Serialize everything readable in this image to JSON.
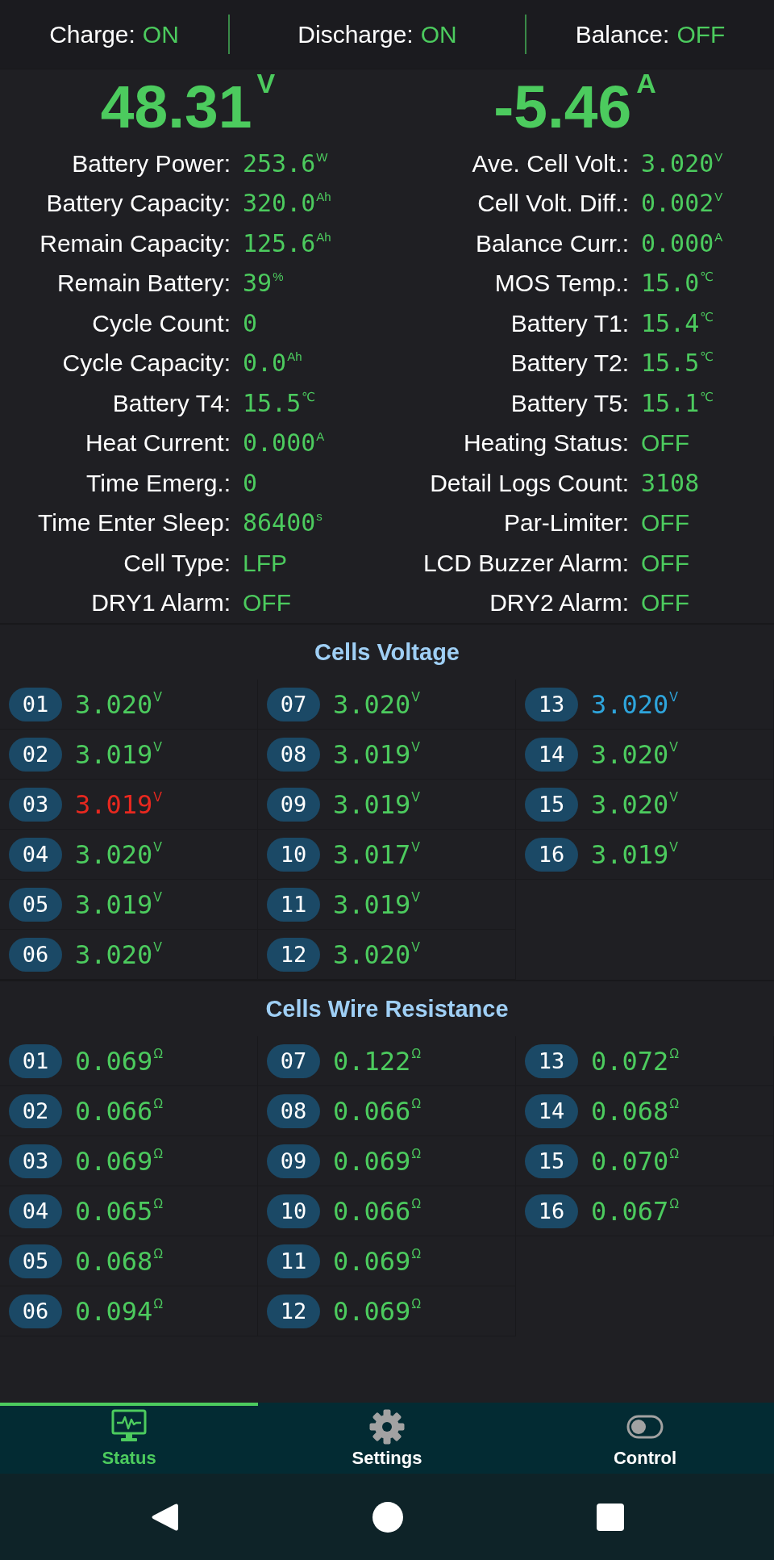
{
  "status_bar": [
    {
      "label": "Charge:",
      "value": "ON"
    },
    {
      "label": "Discharge:",
      "value": "ON"
    },
    {
      "label": "Balance:",
      "value": "OFF"
    }
  ],
  "columns": [
    {
      "reading": {
        "value": "48.31",
        "unit": "V"
      },
      "stats": [
        {
          "label": "Battery Power:",
          "value": "253.6",
          "unit": "W",
          "kind": "number"
        },
        {
          "label": "Battery Capacity:",
          "value": "320.0",
          "unit": "Ah",
          "kind": "number"
        },
        {
          "label": "Remain Capacity:",
          "value": "125.6",
          "unit": "Ah",
          "kind": "number"
        },
        {
          "label": "Remain Battery:",
          "value": "39",
          "unit": "%",
          "kind": "number"
        },
        {
          "label": "Cycle Count:",
          "value": "0",
          "kind": "number"
        },
        {
          "label": "Cycle Capacity:",
          "value": "0.0",
          "unit": "Ah",
          "kind": "number"
        },
        {
          "label": "Battery T4:",
          "value": "15.5",
          "unit": "℃",
          "kind": "number"
        },
        {
          "label": "Heat Current:",
          "value": "0.000",
          "unit": "A",
          "kind": "number"
        },
        {
          "label": "Time Emerg.:",
          "value": "0",
          "kind": "number"
        },
        {
          "label": "Time Enter Sleep:",
          "value": "86400",
          "unit": "s",
          "kind": "number"
        },
        {
          "label": "Cell Type:",
          "value": "LFP",
          "kind": "text"
        },
        {
          "label": "DRY1 Alarm:",
          "value": "OFF",
          "kind": "text"
        }
      ]
    },
    {
      "reading": {
        "value": "-5.46",
        "unit": "A"
      },
      "stats": [
        {
          "label": "Ave. Cell Volt.:",
          "value": "3.020",
          "unit": "V",
          "kind": "number"
        },
        {
          "label": "Cell Volt. Diff.:",
          "value": "0.002",
          "unit": "V",
          "kind": "number"
        },
        {
          "label": "Balance Curr.:",
          "value": "0.000",
          "unit": "A",
          "kind": "number"
        },
        {
          "label": "MOS Temp.:",
          "value": "15.0",
          "unit": "℃",
          "kind": "number"
        },
        {
          "label": "Battery T1:",
          "value": "15.4",
          "unit": "℃",
          "kind": "number"
        },
        {
          "label": "Battery T2:",
          "value": "15.5",
          "unit": "℃",
          "kind": "number"
        },
        {
          "label": "Battery T5:",
          "value": "15.1",
          "unit": "℃",
          "kind": "number"
        },
        {
          "label": "Heating Status:",
          "value": "OFF",
          "kind": "text"
        },
        {
          "label": "Detail Logs Count:",
          "value": "3108",
          "kind": "number"
        },
        {
          "label": "Par-Limiter:",
          "value": "OFF",
          "kind": "text"
        },
        {
          "label": "LCD Buzzer Alarm:",
          "value": "OFF",
          "kind": "text"
        },
        {
          "label": "DRY2 Alarm:",
          "value": "OFF",
          "kind": "text"
        }
      ]
    }
  ],
  "cells_voltage": {
    "title": "Cells Voltage",
    "cells": [
      {
        "number": "01",
        "value": "3.020",
        "unit": "V",
        "color": "#4ccb5e"
      },
      {
        "number": "02",
        "value": "3.019",
        "unit": "V",
        "color": "#4ccb5e"
      },
      {
        "number": "03",
        "value": "3.019",
        "unit": "V",
        "color": "#e8281f"
      },
      {
        "number": "04",
        "value": "3.020",
        "unit": "V",
        "color": "#4ccb5e"
      },
      {
        "number": "05",
        "value": "3.019",
        "unit": "V",
        "color": "#4ccb5e"
      },
      {
        "number": "06",
        "value": "3.020",
        "unit": "V",
        "color": "#4ccb5e"
      },
      {
        "number": "07",
        "value": "3.020",
        "unit": "V",
        "color": "#4ccb5e"
      },
      {
        "number": "08",
        "value": "3.019",
        "unit": "V",
        "color": "#4ccb5e"
      },
      {
        "number": "09",
        "value": "3.019",
        "unit": "V",
        "color": "#4ccb5e"
      },
      {
        "number": "10",
        "value": "3.017",
        "unit": "V",
        "color": "#4ccb5e"
      },
      {
        "number": "11",
        "value": "3.019",
        "unit": "V",
        "color": "#4ccb5e"
      },
      {
        "number": "12",
        "value": "3.020",
        "unit": "V",
        "color": "#4ccb5e"
      },
      {
        "number": "13",
        "value": "3.020",
        "unit": "V",
        "color": "#2ea5dc"
      },
      {
        "number": "14",
        "value": "3.020",
        "unit": "V",
        "color": "#4ccb5e"
      },
      {
        "number": "15",
        "value": "3.020",
        "unit": "V",
        "color": "#4ccb5e"
      },
      {
        "number": "16",
        "value": "3.019",
        "unit": "V",
        "color": "#4ccb5e"
      }
    ]
  },
  "cells_wire_resistance": {
    "title": "Cells Wire Resistance",
    "cells": [
      {
        "number": "01",
        "value": "0.069",
        "unit": "Ω"
      },
      {
        "number": "02",
        "value": "0.066",
        "unit": "Ω"
      },
      {
        "number": "03",
        "value": "0.069",
        "unit": "Ω"
      },
      {
        "number": "04",
        "value": "0.065",
        "unit": "Ω"
      },
      {
        "number": "05",
        "value": "0.068",
        "unit": "Ω"
      },
      {
        "number": "06",
        "value": "0.094",
        "unit": "Ω"
      },
      {
        "number": "07",
        "value": "0.122",
        "unit": "Ω"
      },
      {
        "number": "08",
        "value": "0.066",
        "unit": "Ω"
      },
      {
        "number": "09",
        "value": "0.069",
        "unit": "Ω"
      },
      {
        "number": "10",
        "value": "0.066",
        "unit": "Ω"
      },
      {
        "number": "11",
        "value": "0.069",
        "unit": "Ω"
      },
      {
        "number": "12",
        "value": "0.069",
        "unit": "Ω"
      },
      {
        "number": "13",
        "value": "0.072",
        "unit": "Ω"
      },
      {
        "number": "14",
        "value": "0.068",
        "unit": "Ω"
      },
      {
        "number": "15",
        "value": "0.070",
        "unit": "Ω"
      },
      {
        "number": "16",
        "value": "0.067",
        "unit": "Ω"
      }
    ]
  },
  "tabs": [
    {
      "label": "Status",
      "selected": true
    },
    {
      "label": "Settings",
      "selected": false
    },
    {
      "label": "Control",
      "selected": false
    }
  ]
}
